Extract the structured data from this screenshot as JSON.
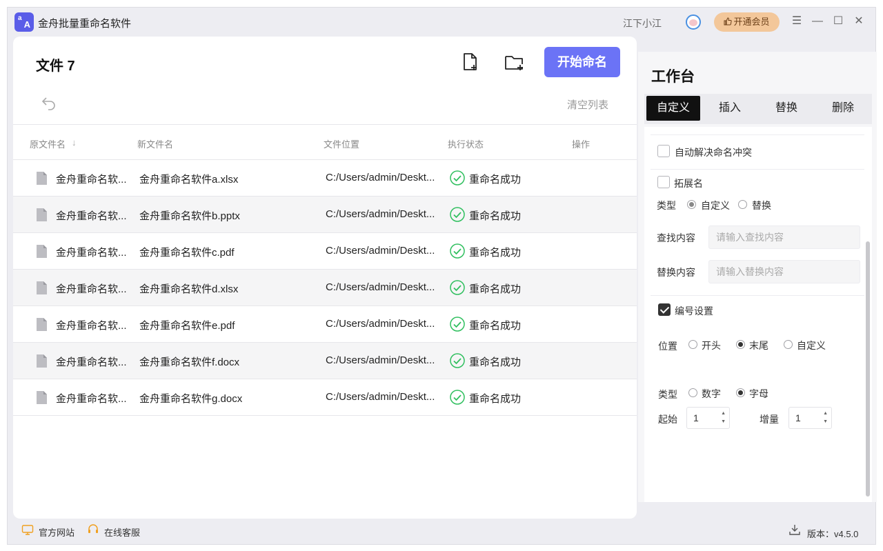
{
  "titlebar": {
    "app_title": "金舟批量重命名软件",
    "logo_letters": [
      "a",
      "A"
    ],
    "username": "江下小江",
    "vip_label": "开通会员",
    "vip_icon": "thumbs-up-icon",
    "controls": {
      "menu": "☰",
      "minimize": "—",
      "maximize": "☐",
      "close": "✕"
    }
  },
  "left_panel": {
    "file_count_label": "文件 7",
    "start_button": "开始命名",
    "clear_list": "清空列表",
    "columns": [
      "原文件名",
      "新文件名",
      "文件位置",
      "执行状态",
      "操作"
    ],
    "rows": [
      {
        "original": "金舟重命名软...",
        "new_name": "金舟重命名软件a.xlsx",
        "location": "C:/Users/admin/Deskt...",
        "status": "重命名成功"
      },
      {
        "original": "金舟重命名软...",
        "new_name": "金舟重命名软件b.pptx",
        "location": "C:/Users/admin/Deskt...",
        "status": "重命名成功"
      },
      {
        "original": "金舟重命名软...",
        "new_name": "金舟重命名软件c.pdf",
        "location": "C:/Users/admin/Deskt...",
        "status": "重命名成功"
      },
      {
        "original": "金舟重命名软...",
        "new_name": "金舟重命名软件d.xlsx",
        "location": "C:/Users/admin/Deskt...",
        "status": "重命名成功"
      },
      {
        "original": "金舟重命名软...",
        "new_name": "金舟重命名软件e.pdf",
        "location": "C:/Users/admin/Deskt...",
        "status": "重命名成功"
      },
      {
        "original": "金舟重命名软...",
        "new_name": "金舟重命名软件f.docx",
        "location": "C:/Users/admin/Deskt...",
        "status": "重命名成功"
      },
      {
        "original": "金舟重命名软...",
        "new_name": "金舟重命名软件g.docx",
        "location": "C:/Users/admin/Deskt...",
        "status": "重命名成功"
      }
    ]
  },
  "workbench": {
    "title": "工作台",
    "tabs": [
      "自定义",
      "插入",
      "替换",
      "删除"
    ],
    "active_tab": "自定义",
    "auto_resolve_conflict": "自动解决命名冲突",
    "extension": {
      "label": "拓展名",
      "type_label": "类型",
      "type_options": [
        "自定义",
        "替换"
      ],
      "find_label": "查找内容",
      "find_placeholder": "请输入查找内容",
      "replace_label": "替换内容",
      "replace_placeholder": "请输入替换内容"
    },
    "numbering": {
      "label": "编号设置",
      "position_label": "位置",
      "position_options": [
        "开头",
        "末尾",
        "自定义"
      ],
      "position_selected": "末尾",
      "type_label": "类型",
      "type_options": [
        "数字",
        "字母"
      ],
      "type_selected": "字母",
      "start_label": "起始",
      "start_value": "1",
      "increment_label": "增量",
      "increment_value": "1"
    }
  },
  "footer": {
    "official_site": "官方网站",
    "online_service": "在线客服",
    "version": "版本：v4.5.0"
  },
  "colors": {
    "accent": "#6b73f6",
    "success": "#2fbf5e",
    "vip": "#f3c79a"
  }
}
